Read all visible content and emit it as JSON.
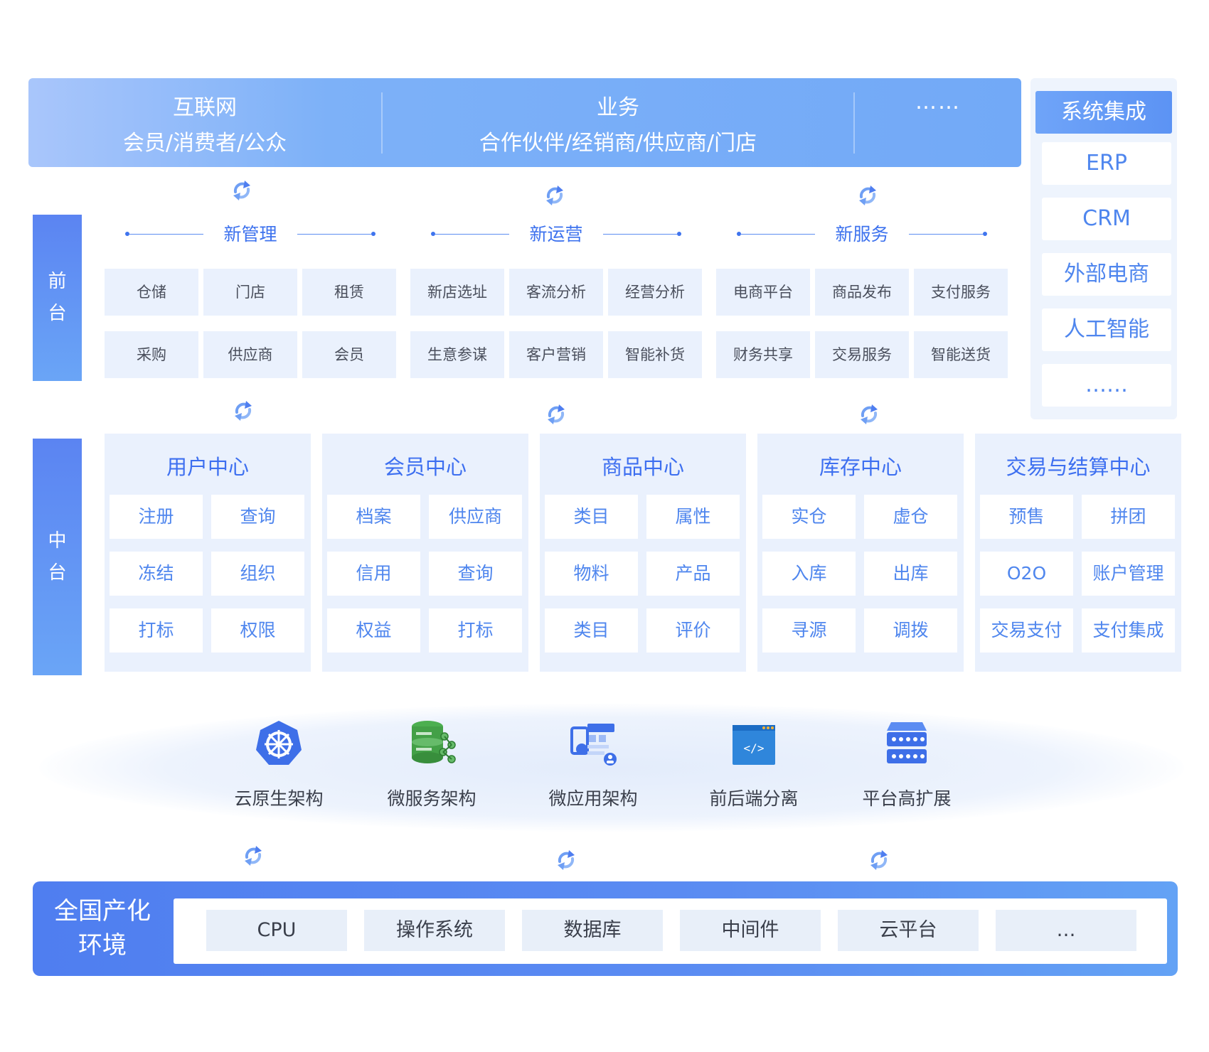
{
  "top_banner": {
    "internet": {
      "title": "互联网",
      "subtitle": "会员/消费者/公众"
    },
    "business": {
      "title": "业务",
      "subtitle": "合作伙伴/经销商/供应商/门店"
    },
    "more": "……"
  },
  "system_integration": {
    "title": "系统集成",
    "items": [
      "ERP",
      "CRM",
      "外部电商",
      "人工智能",
      "……"
    ]
  },
  "side_labels": {
    "front": [
      "前",
      "台"
    ],
    "middle": [
      "中",
      "台"
    ]
  },
  "front_tier": {
    "groups": [
      {
        "title": "新管理",
        "cells": [
          "仓储",
          "门店",
          "租赁",
          "采购",
          "供应商",
          "会员"
        ]
      },
      {
        "title": "新运营",
        "cells": [
          "新店选址",
          "客流分析",
          "经营分析",
          "生意参谋",
          "客户营销",
          "智能补货"
        ]
      },
      {
        "title": "新服务",
        "cells": [
          "电商平台",
          "商品发布",
          "支付服务",
          "财务共享",
          "交易服务",
          "智能送货"
        ]
      }
    ]
  },
  "middle_tier": {
    "panels": [
      {
        "title": "用户中心",
        "cells": [
          "注册",
          "查询",
          "冻结",
          "组织",
          "打标",
          "权限"
        ]
      },
      {
        "title": "会员中心",
        "cells": [
          "档案",
          "供应商",
          "信用",
          "查询",
          "权益",
          "打标"
        ]
      },
      {
        "title": "商品中心",
        "cells": [
          "类目",
          "属性",
          "物料",
          "产品",
          "类目",
          "评价"
        ]
      },
      {
        "title": "库存中心",
        "cells": [
          "实仓",
          "虚仓",
          "入库",
          "出库",
          "寻源",
          "调拨"
        ]
      },
      {
        "title": "交易与结算中心",
        "cells": [
          "预售",
          "拼团",
          "O2O",
          "账户管理",
          "交易支付",
          "支付集成"
        ]
      }
    ]
  },
  "architecture": [
    {
      "label": "云原生架构",
      "icon": "kubernetes-helm-icon"
    },
    {
      "label": "微服务架构",
      "icon": "database-network-icon"
    },
    {
      "label": "微应用架构",
      "icon": "app-window-icon"
    },
    {
      "label": "前后端分离",
      "icon": "code-window-icon"
    },
    {
      "label": "平台高扩展",
      "icon": "server-rack-icon"
    }
  ],
  "domestic_env": {
    "title_lines": [
      "全国产化",
      "环境"
    ],
    "items": [
      "CPU",
      "操作系统",
      "数据库",
      "中间件",
      "云平台",
      "…"
    ]
  },
  "colors": {
    "accent": "#3d72ee",
    "panel_bg": "#eaf1fd",
    "banner_start": "#a9c6fb",
    "banner_end": "#72a9f7"
  }
}
